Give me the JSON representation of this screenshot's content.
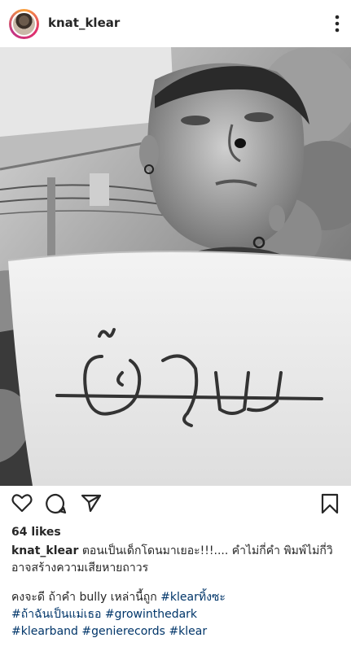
{
  "post": {
    "username": "knat_klear",
    "likes": "64 likes",
    "caption": {
      "username": "knat_klear",
      "line1": "ตอนเป็นเด็กโดนมาเยอะ!!!.... คำไม่กี่คำ พิมพ์ไม่กี่วิ",
      "line2": "อาจสร้างความเสียหายถาวร",
      "line3_text": "คงจะดี ถ้าคำ bully เหล่านี้ถูก ",
      "line3_tag": "#klearทิ้งซะ",
      "line4_tag": "#ถ้าฉันเป็นแม่เธอ",
      "line4_tag2": "#growinthedark",
      "line5_tag1": "#klearband",
      "line5_tag2": "#genierecords",
      "line5_tag3": "#klear"
    },
    "photo": {
      "handwritten_word": "อ้วน"
    }
  },
  "icons": [
    "more-vertical-icon",
    "heart-icon",
    "comment-icon",
    "share-icon",
    "bookmark-icon"
  ]
}
